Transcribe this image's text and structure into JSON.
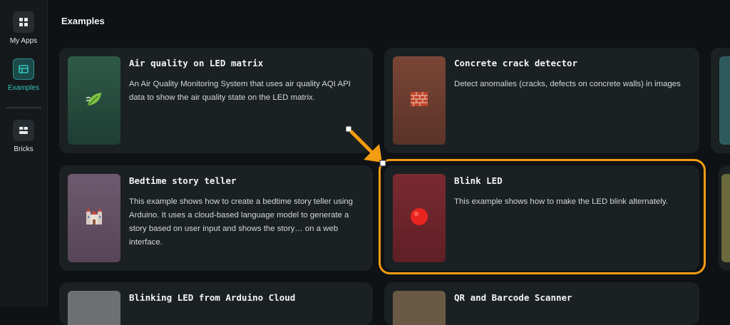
{
  "sidebar": {
    "items": [
      {
        "label": "My Apps",
        "icon": "grid-icon"
      },
      {
        "label": "Examples",
        "icon": "examples-icon",
        "active": true
      },
      {
        "label": "Bricks",
        "icon": "bricks-icon"
      }
    ]
  },
  "main": {
    "section_title": "Examples",
    "cards": [
      {
        "title": "Air quality on LED matrix",
        "description": "An Air Quality Monitoring System that uses air quality AQI API data to show the air quality state on the LED matrix.",
        "icon": "leaf-icon"
      },
      {
        "title": "Concrete crack detector",
        "description": "Detect anomalies (cracks, defects on concrete walls) in images",
        "icon": "brick-icon"
      },
      {
        "title": "Bedtime story teller",
        "description": "This example shows how to create a bedtime story teller using Arduino. It uses a cloud-based language model to generate a story based on user input and shows the story… on a web interface.",
        "icon": "castle-icon"
      },
      {
        "title": "Blink LED",
        "description": "This example shows how to make the LED blink alternately.",
        "icon": "red-circle-icon"
      },
      {
        "title": "Blinking LED from Arduino Cloud",
        "description": "",
        "icon": ""
      },
      {
        "title": "QR and Barcode Scanner",
        "description": "",
        "icon": ""
      }
    ]
  },
  "colors": {
    "accent": "#33c6bd",
    "highlight": "#f39c12",
    "background": "#0f1214",
    "card": "#1b2023"
  }
}
